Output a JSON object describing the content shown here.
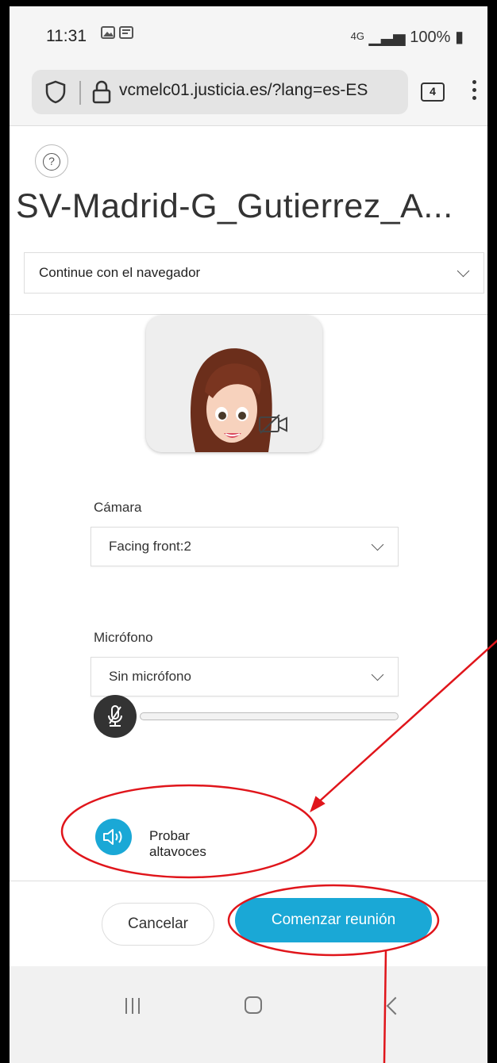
{
  "status_bar": {
    "time": "11:31",
    "network": "4G",
    "battery": "100%"
  },
  "browser": {
    "url": "vcmelc01.justicia.es/?lang=es-ES",
    "tab_count": "4"
  },
  "page": {
    "meeting_title": "SV-Madrid-G_Gutierrez_A...",
    "join_mode": "Continue con el navegador"
  },
  "camera": {
    "label": "Cámara",
    "selected": "Facing front:2"
  },
  "microphone": {
    "label": "Micrófono",
    "selected": "Sin micrófono",
    "level": 0
  },
  "speaker": {
    "label": "Probar altavoces"
  },
  "actions": {
    "cancel": "Cancelar",
    "start": "Comenzar reunión"
  },
  "colors": {
    "accent": "#1aa8d6",
    "annotation": "#e0151b"
  },
  "icons": [
    "help-icon",
    "shield-icon",
    "lock-icon",
    "camera-off-icon",
    "mic-muted-icon",
    "speaker-icon"
  ]
}
